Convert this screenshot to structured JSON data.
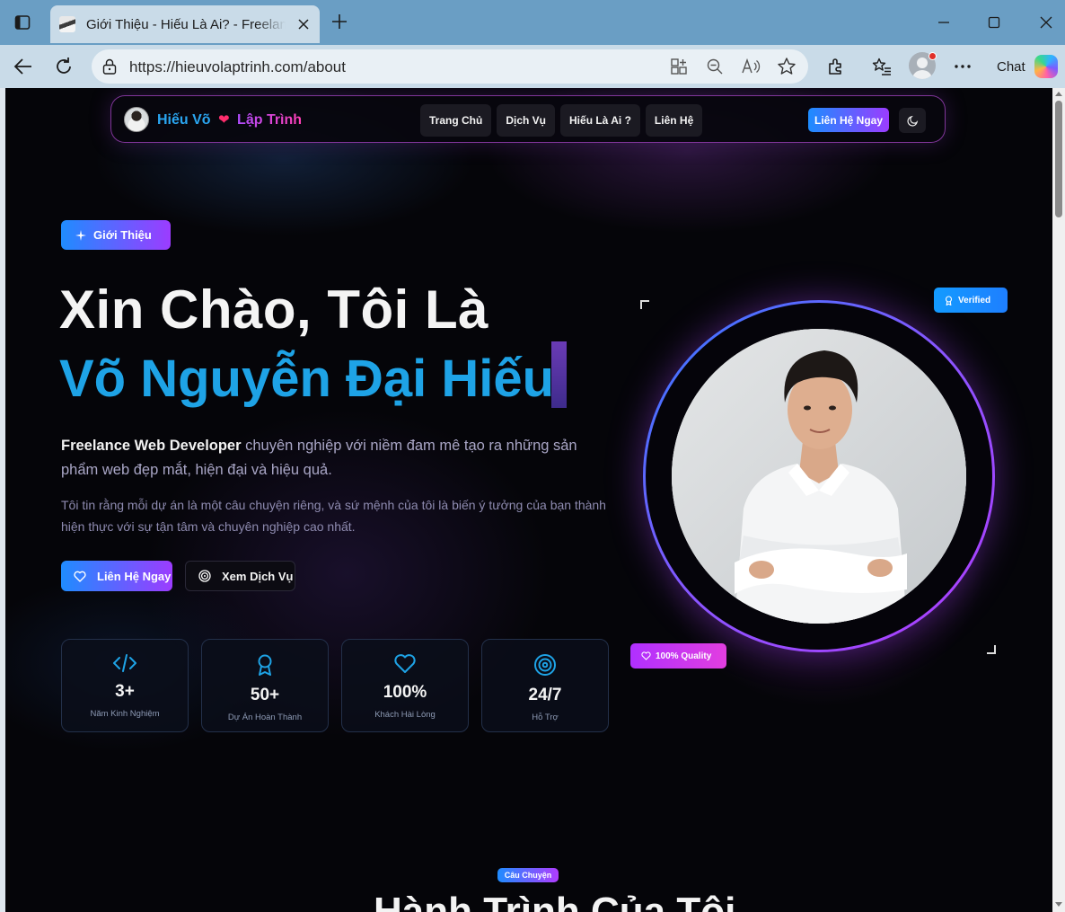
{
  "browser": {
    "tab_title": "Giới Thiệu - Hiếu Là Ai? - Freelancer",
    "url": "https://hieuvolaptrinh.com/about",
    "chat_label": "Chat"
  },
  "site": {
    "logo_part1": "Hiếu Võ",
    "logo_heart": "❤",
    "logo_part2": "Lập Trình",
    "nav": [
      "Trang Chủ",
      "Dịch Vụ",
      "Hiếu Là Ai ?",
      "Liên Hệ"
    ],
    "nav_cta": "Liên Hệ Ngay"
  },
  "hero": {
    "badge": "Giới Thiệu",
    "line1": "Xin Chào, Tôi Là",
    "line2": "Võ Nguyễn Đại Hiếu",
    "desc_strong": "Freelance Web Developer",
    "desc_rest": " chuyên nghiệp với niềm đam mê tạo ra những sản phẩm web đẹp mắt, hiện đại và hiệu quả.",
    "desc2": "Tôi tin rằng mỗi dự án là một câu chuyện riêng, và sứ mệnh của tôi là biến ý tưởng của bạn thành hiện thực với sự tận tâm và chuyên nghiệp cao nhất.",
    "btn_contact": "Liên Hệ Ngay",
    "btn_services": "Xem Dịch Vụ",
    "verified": "Verified",
    "quality": "100% Quality"
  },
  "stats": [
    {
      "icon": "code-icon",
      "value": "3+",
      "label": "Năm Kinh Nghiệm"
    },
    {
      "icon": "award-icon",
      "value": "50+",
      "label": "Dự Án Hoàn Thành"
    },
    {
      "icon": "heart-icon",
      "value": "100%",
      "label": "Khách Hài Lòng"
    },
    {
      "icon": "target-icon",
      "value": "24/7",
      "label": "Hỗ Trợ"
    }
  ],
  "story": {
    "badge": "Câu Chuyện",
    "title": "Hành Trình Của Tôi"
  },
  "colors": {
    "accent_blue": "#1ea3e6",
    "gradient_start": "#1f8cff",
    "gradient_end": "#9c3cff",
    "background": "#050509"
  }
}
